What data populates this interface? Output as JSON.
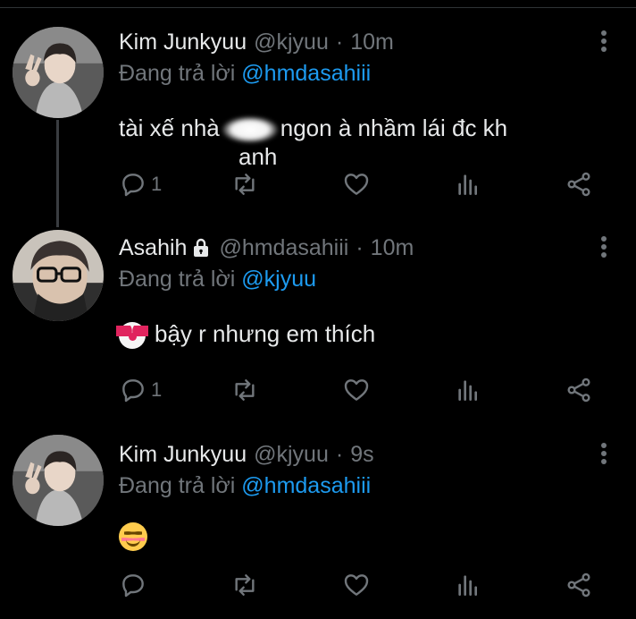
{
  "tweets": [
    {
      "name": "Kim Junkyuu",
      "handle": "@kjyuu",
      "sep": "·",
      "time": "10m",
      "reply_prefix": "Đang trả lời",
      "reply_to": "@hmdasahiii",
      "text_before": "tài xế nhà",
      "text_after": "ngon à nhầm lái đc kh",
      "text_line2": "anh",
      "reply_count": "1",
      "avatar": "person-peace-sign"
    },
    {
      "name": "Asahih",
      "handle": "@hmdasahiii",
      "sep": "·",
      "time": "10m",
      "reply_prefix": "Đang trả lời",
      "reply_to": "@kjyuu",
      "text": "bậy r nhưng em thích",
      "emoji": "clown-face",
      "reply_count": "1",
      "protected_icon": "lock-icon",
      "avatar": "person-with-glasses"
    },
    {
      "name": "Kim Junkyuu",
      "handle": "@kjyuu",
      "sep": "·",
      "time": "9s",
      "reply_prefix": "Đang trả lời",
      "reply_to": "@hmdasahiii",
      "emoji": "smiling-face-with-smiling-eyes",
      "reply_count": "",
      "avatar": "person-peace-sign"
    }
  ],
  "icons": [
    "reply-icon",
    "retweet-icon",
    "like-icon",
    "analytics-icon",
    "share-icon",
    "more-icon"
  ],
  "colors": {
    "background": "#000000",
    "text": "#e7e9ea",
    "muted": "#71767b",
    "link": "#1d9bf0"
  }
}
